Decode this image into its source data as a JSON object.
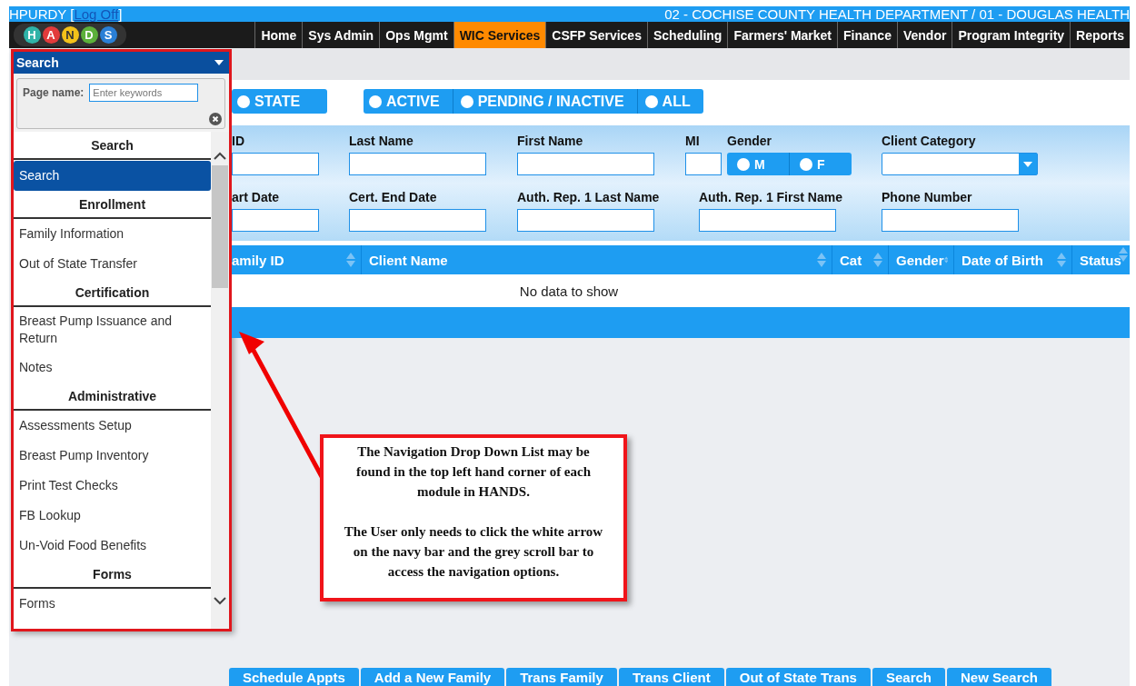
{
  "header": {
    "user": "HPURDY [",
    "link": "Log Off",
    "suffix": "]",
    "agency": "02 - COCHISE COUNTY HEALTH DEPARTMENT / 01 - DOUGLAS HEALTH"
  },
  "logo": [
    "H",
    "A",
    "N",
    "D",
    "S"
  ],
  "menu": [
    {
      "label": "Home",
      "selected": false
    },
    {
      "label": "Sys Admin",
      "selected": false
    },
    {
      "label": "Ops Mgmt",
      "selected": false
    },
    {
      "label": "WIC Services",
      "selected": true
    },
    {
      "label": "CSFP Services",
      "selected": false
    },
    {
      "label": "Scheduling",
      "selected": false
    },
    {
      "label": "Farmers' Market",
      "selected": false
    },
    {
      "label": "Finance",
      "selected": false
    },
    {
      "label": "Vendor",
      "selected": false
    },
    {
      "label": "Program Integrity",
      "selected": false
    },
    {
      "label": "Reports",
      "selected": false
    }
  ],
  "nav_dropdown": {
    "title": "Search",
    "search_label": "Page name:",
    "placeholder": "Enter keywords",
    "groups": [
      {
        "header": "Search",
        "items": [
          {
            "label": "Search",
            "selected": true
          }
        ]
      },
      {
        "header": "Enrollment",
        "items": [
          {
            "label": "Family Information",
            "selected": false
          },
          {
            "label": "Out of State Transfer",
            "selected": false
          }
        ]
      },
      {
        "header": "Certification",
        "items": [
          {
            "label": "Breast Pump Issuance and Return",
            "selected": false
          },
          {
            "label": "Notes",
            "selected": false
          }
        ]
      },
      {
        "header": "Administrative",
        "items": [
          {
            "label": "Assessments Setup",
            "selected": false
          },
          {
            "label": "Breast Pump Inventory",
            "selected": false
          },
          {
            "label": "Print Test Checks",
            "selected": false
          },
          {
            "label": "FB Lookup",
            "selected": false
          },
          {
            "label": "Un-Void Food Benefits",
            "selected": false
          }
        ]
      },
      {
        "header": "Forms",
        "items": [
          {
            "label": "Forms",
            "selected": false
          }
        ]
      }
    ]
  },
  "filters": [
    [
      {
        "label": "STATE",
        "selected": false
      }
    ],
    [
      {
        "label": "ACTIVE",
        "selected": false
      },
      {
        "label": "PENDING / INACTIVE",
        "selected": false
      },
      {
        "label": "ALL",
        "selected": false
      }
    ]
  ],
  "search_form": [
    [
      {
        "kind": "text",
        "label": "ID"
      },
      {
        "kind": "text",
        "label": "Last Name"
      },
      {
        "kind": "text",
        "label": "First Name"
      },
      {
        "kind": "text",
        "label": "MI"
      },
      {
        "kind": "segmented",
        "label": "Gender",
        "options": [
          {
            "label": "M",
            "selected": false
          },
          {
            "label": "F",
            "selected": false
          }
        ]
      },
      {
        "kind": "select",
        "label": "Client Category"
      }
    ],
    [
      {
        "kind": "text",
        "label": "art Date"
      },
      {
        "kind": "text",
        "label": "Cert. End Date"
      },
      {
        "kind": "text",
        "label": "Auth. Rep. 1 Last Name"
      },
      {
        "kind": "text",
        "label": "Auth. Rep. 1 First Name"
      },
      {
        "kind": "text",
        "label": "Phone Number"
      }
    ]
  ],
  "table": {
    "columns": [
      "amily ID",
      "Client Name",
      "Cat",
      "Gender",
      "Date of Birth",
      "Status"
    ],
    "empty_message": "No data to show"
  },
  "callout": {
    "paragraphs": [
      "The Navigation Drop Down List may be found in the top left hand corner of each module in HANDS.",
      "The User only needs to click the white arrow on the navy bar and the grey scroll bar to access the navigation options."
    ]
  },
  "buttons": [
    "Schedule Appts",
    "Add a New Family",
    "Trans Family",
    "Trans Client",
    "Out of State Trans",
    "Search",
    "New Search"
  ]
}
